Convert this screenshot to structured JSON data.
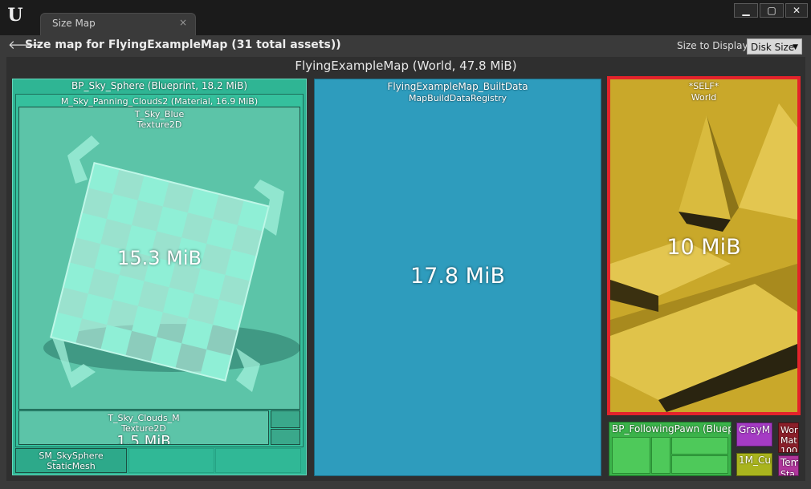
{
  "window": {
    "tab_label": "Size Map",
    "tab_close": "×",
    "minimize": "▁",
    "maximize": "▢",
    "close": "✕",
    "logo": "U"
  },
  "header": {
    "back_icon": "arrow-left",
    "title": "Size map for FlyingExampleMap  (31 total assets))",
    "size_to_display_label": "Size to Display:",
    "size_to_display_value": "Disk Size",
    "caret": "▼"
  },
  "colors": {
    "teal": "#33c4a1",
    "blue": "#2e9cbd",
    "gold": "#c9a82a",
    "selected_border": "#e3232b",
    "green": "#3bb34a",
    "purple": "#a53bc4",
    "olive": "#a9b41e",
    "dark_red": "#8a1f2a",
    "magenta": "#b0369c"
  },
  "treemap": {
    "root": {
      "title": "FlyingExampleMap  (World, 47.8 MiB)"
    },
    "sky_sphere": {
      "title": "BP_Sky_Sphere  (Blueprint, 18.2 MiB)",
      "material": {
        "title": "M_Sky_Panning_Clouds2  (Material, 16.9 MiB)",
        "texture_blue": {
          "name": "T_Sky_Blue",
          "type": "Texture2D",
          "size": "15.3 MiB"
        },
        "texture_clouds": {
          "name": "T_Sky_Clouds_M",
          "type": "Texture2D",
          "size": "1.5 MiB"
        }
      },
      "mesh": {
        "name": "SM_SkySphere",
        "type": "StaticMesh"
      }
    },
    "built_data": {
      "name": "FlyingExampleMap_BuiltData",
      "type": "MapBuildDataRegistry",
      "size": "17.8 MiB"
    },
    "self": {
      "name": "*SELF*",
      "type": "World",
      "size": "10 MiB"
    },
    "following_pawn": {
      "title": "BP_FollowingPawn  (Bluep"
    },
    "small": [
      {
        "name": "GrayM"
      },
      {
        "name": "1M_Cu"
      },
      {
        "name": "Wor",
        "line2": "Mat",
        "line3": "100"
      },
      {
        "name": "Tem",
        "line2": "Sta"
      }
    ]
  }
}
